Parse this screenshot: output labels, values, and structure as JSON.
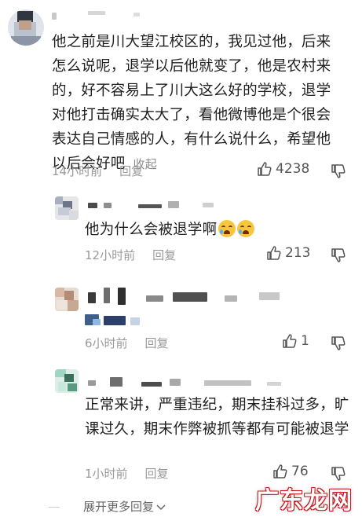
{
  "comments": [
    {
      "text": "他之前是川大望江校区的，我见过他，后来怎么说呢，退学以后他就变了，他是农村来的，好不容易上了川大这么好的学校，退学对他打击确实太大了，看他微博他是个很会表达自己情感的人，有什么说什么，希望他以后会好吧",
      "collapse_label": "收起",
      "time": "14小时前",
      "reply_label": "回复",
      "likes": "4238"
    },
    {
      "text": "他为什么会被退学啊",
      "time": "12小时前",
      "reply_label": "回复",
      "likes": "213"
    },
    {
      "text": "",
      "time": "6小时前",
      "reply_label": "回复",
      "likes": "1"
    },
    {
      "text": "正常来讲，严重违纪，期末挂科过多，旷课过久，期末作弊被抓等都有可能被退学",
      "time": "1小时前",
      "reply_label": "回复",
      "likes": "76"
    }
  ],
  "footer": {
    "expand_label": "展开更多回复",
    "watermark": "广东龙网"
  },
  "icons": {
    "like": "thumb-up-icon",
    "dislike": "thumb-down-icon",
    "emoji": "crying-face-emoji",
    "expand": "chevron-down-icon"
  },
  "colors": {
    "text": "#1f1f1f",
    "meta": "#9a9a9a",
    "watermark_red": "#c8161d"
  }
}
